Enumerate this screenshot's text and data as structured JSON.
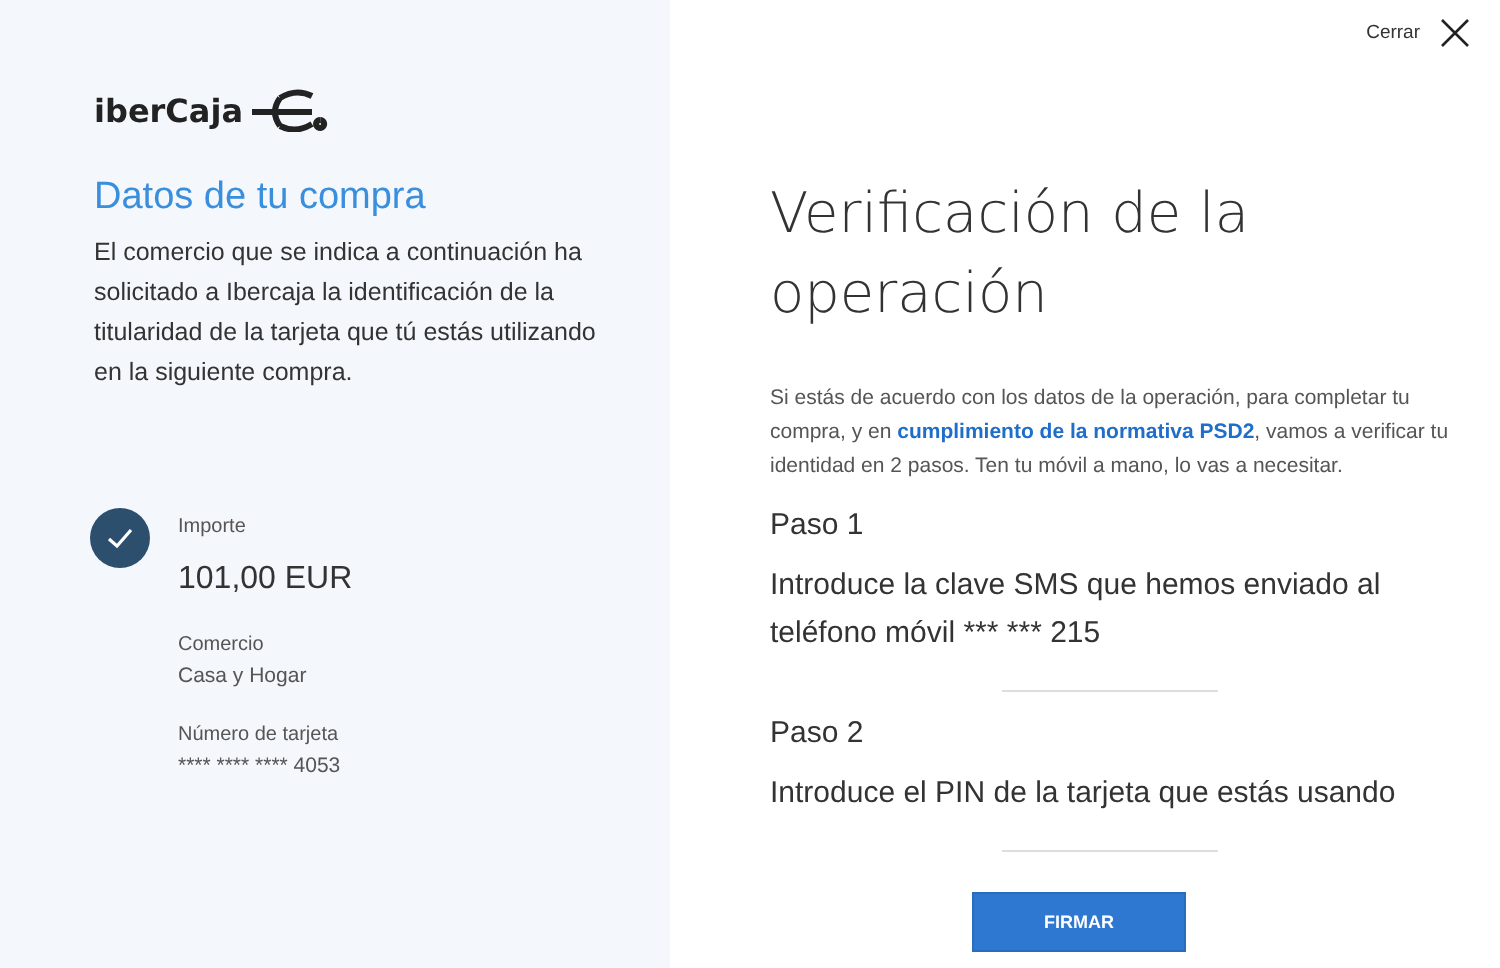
{
  "logo": {
    "text": "iberCaja"
  },
  "purchase": {
    "title": "Datos de tu compra",
    "description": "El comercio que se indica a continuación ha solicitado a Ibercaja la identificación de la titularidad de la tarjeta que tú estás utilizando en la siguiente compra.",
    "fields": [
      {
        "label": "Importe",
        "value": "101,00 EUR",
        "kind": "amount"
      },
      {
        "label": "Comercio",
        "value": "Casa y Hogar",
        "kind": "plain"
      },
      {
        "label": "Número de tarjeta",
        "value": "**** **** **** 4053",
        "kind": "plain"
      }
    ]
  },
  "close": {
    "label": "Cerrar"
  },
  "verification": {
    "title": "Verificación de la operación",
    "intro_before": "Si estás de acuerdo con los datos de la operación, para completar tu compra, y en",
    "intro_link": "cumplimiento de la normativa PSD2",
    "intro_after": ", vamos a verificar tu identidad en 2 pasos. Ten tu móvil a mano, lo vas a necesitar.",
    "steps": [
      {
        "title": "Paso 1",
        "text": "Introduce la clave SMS que hemos enviado al teléfono móvil *** *** 215"
      },
      {
        "title": "Paso 2",
        "text": "Introduce el PIN de la tarjeta que estás usando"
      }
    ],
    "button": "FIRMAR"
  }
}
